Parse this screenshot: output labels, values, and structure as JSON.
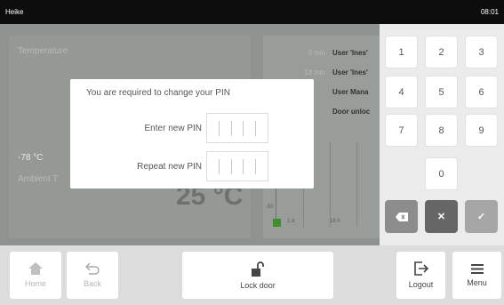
{
  "status_bar": {
    "user": "Heike",
    "time": "08:01"
  },
  "dashboard": {
    "temperature_card": {
      "title": "Temperature",
      "current": "-78 °C",
      "ambient_label": "Ambient T",
      "big_value": "25 °C"
    },
    "event_log": [
      {
        "time": "0 min",
        "message": "User 'Ines'"
      },
      {
        "time": "13 min",
        "message": "User 'Ines'"
      },
      {
        "time": "",
        "message": "User Mana"
      },
      {
        "time": "",
        "message": "Door unloc"
      }
    ],
    "chart": {
      "y_min_label": "-50",
      "x_labels": [
        "1 d",
        "18 h"
      ]
    }
  },
  "dialog": {
    "message": "You are required to change your PIN",
    "new_pin_label": "Enter new PIN",
    "repeat_pin_label": "Repeat new PIN"
  },
  "keypad": {
    "keys": [
      "1",
      "2",
      "3",
      "4",
      "5",
      "6",
      "7",
      "8",
      "9",
      "0"
    ],
    "backspace_icon": "backspace-icon",
    "cancel_icon": "close-icon",
    "confirm_icon": "checkmark-icon"
  },
  "bottom_bar": {
    "home": "Home",
    "back": "Back",
    "lock": "Lock door",
    "logout": "Logout",
    "menu": "Menu"
  }
}
